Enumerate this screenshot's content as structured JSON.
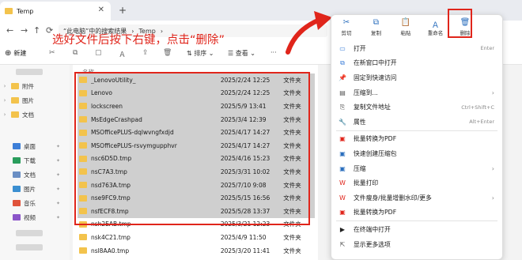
{
  "window": {
    "tab_title": "Temp",
    "close": "✕",
    "new_tab": "+"
  },
  "address": {
    "back": "←",
    "forward": "→",
    "up": "↑",
    "refresh": "⟳",
    "crumbs": [
      "“此电脑”中的搜索结果",
      "›",
      "Temp",
      "›"
    ]
  },
  "toolbar": {
    "new_label": "新建",
    "sort_label": "排序",
    "view_label": "查看",
    "more": "···"
  },
  "annotation": {
    "text": "选好文件后按下右键，点击“删除”",
    "color": "#e0251b"
  },
  "sidebar": {
    "items": [
      {
        "label": "附件",
        "icon": "folder-icon",
        "color": "#f3c34c"
      },
      {
        "label": "图片",
        "icon": "folder-icon",
        "color": "#f3c34c"
      },
      {
        "label": "文档",
        "icon": "folder-icon",
        "color": "#f3c34c"
      },
      {
        "label": "桌面",
        "icon": "desktop-icon",
        "color": "#3d7fd8"
      },
      {
        "label": "下载",
        "icon": "download-icon",
        "color": "#2a9d5c"
      },
      {
        "label": "文档",
        "icon": "documents-icon",
        "color": "#6b8fc4"
      },
      {
        "label": "图片",
        "icon": "pictures-icon",
        "color": "#3b8fd1"
      },
      {
        "label": "音乐",
        "icon": "music-icon",
        "color": "#e0533b"
      },
      {
        "label": "视频",
        "icon": "video-icon",
        "color": "#8b55c9"
      }
    ]
  },
  "files": {
    "header_name": "名称",
    "rows": [
      {
        "name": "_LenovoUtility_",
        "date": "2025/2/24 12:25",
        "type": "文件夹",
        "selected": true
      },
      {
        "name": "Lenovo",
        "date": "2025/2/24 12:25",
        "type": "文件夹",
        "selected": true
      },
      {
        "name": "lockscreen",
        "date": "2025/5/9 13:41",
        "type": "文件夹",
        "selected": true
      },
      {
        "name": "MsEdgeCrashpad",
        "date": "2025/3/4 12:39",
        "type": "文件夹",
        "selected": true
      },
      {
        "name": "MSOfficePLUS-dqlwvngfxdjd",
        "date": "2025/4/17 14:27",
        "type": "文件夹",
        "selected": true
      },
      {
        "name": "MSOfficePLUS-rsvymgupphvr",
        "date": "2025/4/17 14:27",
        "type": "文件夹",
        "selected": true
      },
      {
        "name": "nsc6D5D.tmp",
        "date": "2025/4/16 15:23",
        "type": "文件夹",
        "selected": true
      },
      {
        "name": "nsC7A3.tmp",
        "date": "2025/3/31 10:02",
        "type": "文件夹",
        "selected": true
      },
      {
        "name": "nsd763A.tmp",
        "date": "2025/7/10 9:08",
        "type": "文件夹",
        "selected": true
      },
      {
        "name": "nse9FC9.tmp",
        "date": "2025/5/15 16:56",
        "type": "文件夹",
        "selected": true
      },
      {
        "name": "nsfECF8.tmp",
        "date": "2025/5/28 13:37",
        "type": "文件夹",
        "selected": true
      },
      {
        "name": "nsh2EAB.tmp",
        "date": "2025/3/21 12:23",
        "type": "文件夹",
        "selected": false
      },
      {
        "name": "nsk4C21.tmp",
        "date": "2025/4/9 11:50",
        "type": "文件夹",
        "selected": false
      },
      {
        "name": "nsl8AA0.tmp",
        "date": "2025/3/20 11:41",
        "type": "文件夹",
        "selected": false
      }
    ]
  },
  "context_menu": {
    "top_actions": [
      {
        "label": "剪切",
        "glyph": "✂"
      },
      {
        "label": "复制",
        "glyph": "⧉"
      },
      {
        "label": "粘贴",
        "glyph": "📋"
      },
      {
        "label": "重命名",
        "glyph": "Ａ"
      },
      {
        "label": "删除",
        "glyph": "🗑"
      }
    ],
    "items": [
      {
        "label": "打开",
        "shortcut": "Enter",
        "icon": "open-icon",
        "glyph": "▭",
        "color": "#3d7fd8"
      },
      {
        "label": "在新窗口中打开",
        "shortcut": "",
        "icon": "new-window-icon",
        "glyph": "⧉",
        "color": "#3d7fd8"
      },
      {
        "label": "固定到快速访问",
        "shortcut": "",
        "icon": "pin-icon",
        "glyph": "📌",
        "color": "#3d7fd8"
      },
      {
        "label": "压缩到...",
        "shortcut": "",
        "icon": "compress-icon",
        "glyph": "▤",
        "color": "#555",
        "submenu": true
      },
      {
        "label": "复制文件地址",
        "shortcut": "Ctrl+Shift+C",
        "icon": "copy-path-icon",
        "glyph": "⎘",
        "color": "#555"
      },
      {
        "label": "属性",
        "shortcut": "Alt+Enter",
        "icon": "properties-icon",
        "glyph": "🔧",
        "color": "#555"
      },
      {
        "label": "批量转换为PDF",
        "shortcut": "",
        "icon": "pdf-convert-icon",
        "glyph": "▣",
        "color": "#e0251b"
      },
      {
        "label": "快速创建压缩包",
        "shortcut": "",
        "icon": "quick-zip-icon",
        "glyph": "▣",
        "color": "#2a6ebd"
      },
      {
        "label": "压缩",
        "shortcut": "",
        "icon": "zip-icon",
        "glyph": "▣",
        "color": "#2a6ebd",
        "submenu": true
      },
      {
        "label": "批量打印",
        "shortcut": "",
        "icon": "print-icon",
        "glyph": "W",
        "color": "#e0251b"
      },
      {
        "label": "文件瘦身/批量增删水印/更多",
        "shortcut": "",
        "icon": "pdf-tools-icon",
        "glyph": "W",
        "color": "#e0251b",
        "submenu": true
      },
      {
        "label": "批量转换为PDF",
        "shortcut": "",
        "icon": "pdf-batch-icon",
        "glyph": "▣",
        "color": "#e0251b"
      },
      {
        "label": "在终端中打开",
        "shortcut": "",
        "icon": "terminal-icon",
        "glyph": "▶",
        "color": "#222"
      },
      {
        "label": "显示更多选项",
        "shortcut": "",
        "icon": "more-options-icon",
        "glyph": "⇱",
        "color": "#555"
      }
    ]
  }
}
